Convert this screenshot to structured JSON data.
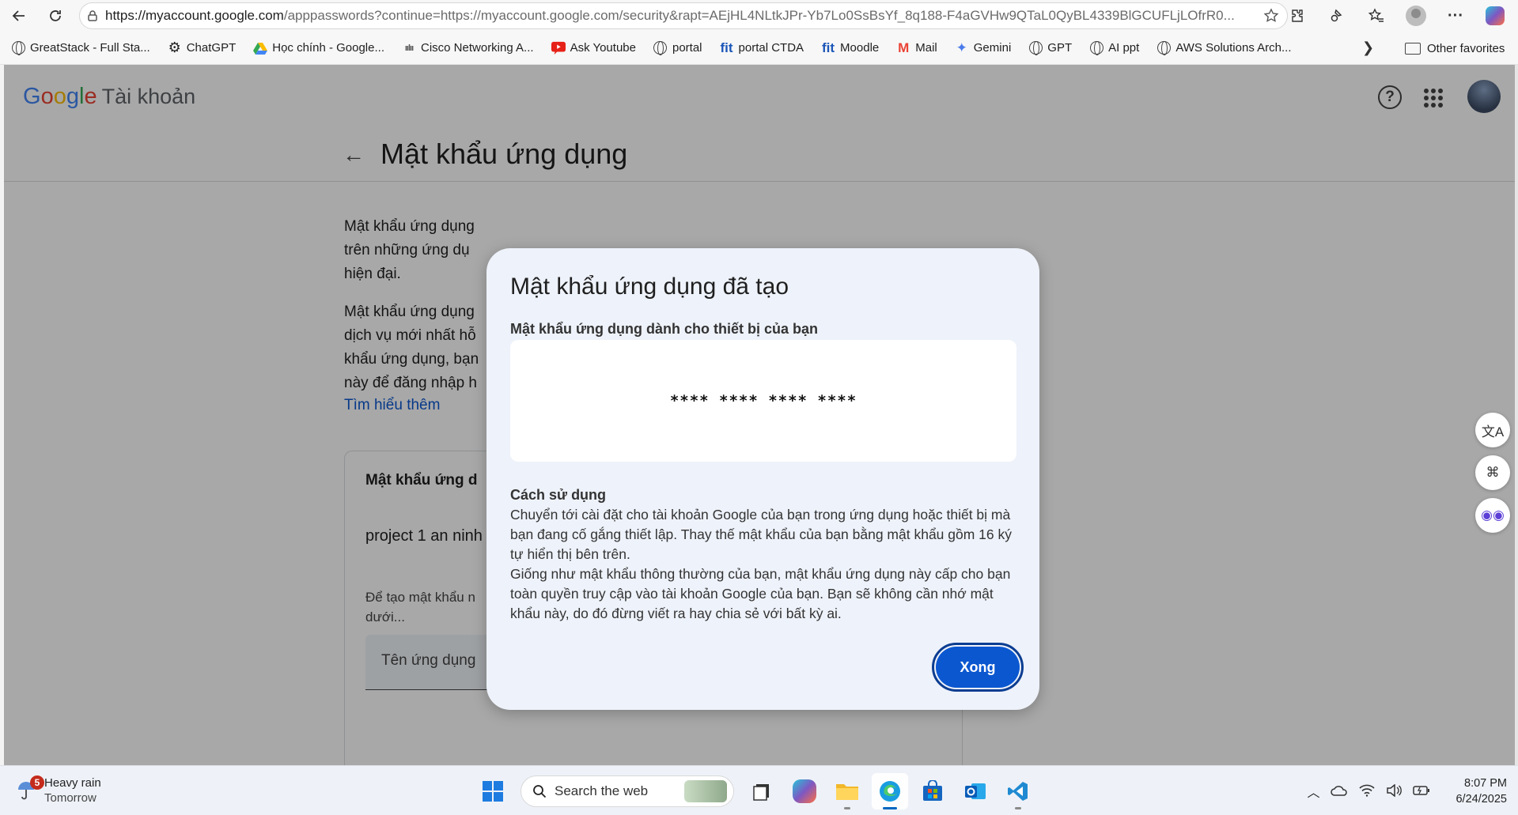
{
  "browser": {
    "url_main": "https://myaccount.google.com",
    "url_rest": "/apppasswords?continue=https://myaccount.google.com/security&rapt=AEjHL4NLtkJPr-Yb7Lo0SsBsYf_8q188-F4aGVHw9QTaL0QyBL4339BlGCUFLjLOfrR0...",
    "bookmarks": [
      {
        "label": "GreatStack - Full Sta...",
        "icon": "globe-icon"
      },
      {
        "label": "ChatGPT",
        "icon": "chatgpt-icon"
      },
      {
        "label": "Học chính - Google...",
        "icon": "google-drive-icon"
      },
      {
        "label": "Cisco Networking A...",
        "icon": "cisco-icon"
      },
      {
        "label": "Ask Youtube",
        "icon": "youtube-icon"
      },
      {
        "label": "portal",
        "icon": "globe-icon"
      },
      {
        "label": "portal CTDA",
        "icon": "fit-icon"
      },
      {
        "label": "Moodle",
        "icon": "fit-icon"
      },
      {
        "label": "Mail",
        "icon": "gmail-icon"
      },
      {
        "label": "Gemini",
        "icon": "gemini-icon"
      },
      {
        "label": "GPT",
        "icon": "globe-icon"
      },
      {
        "label": "AI ppt",
        "icon": "globe-icon"
      },
      {
        "label": "AWS Solutions Arch...",
        "icon": "globe-icon"
      }
    ],
    "other_favorites": "Other favorites"
  },
  "google": {
    "logo": "Google",
    "product": "Tài khoản",
    "page_title": "Mật khẩu ứng dụng",
    "para1": [
      "Mật khẩu ứng dụng",
      "trên những ứng dụ",
      "hiện đại."
    ],
    "para2": [
      "Mật khẩu ứng dụng",
      "dịch vụ mới nhất hỗ",
      "khẩu ứng dụng, bạn",
      "này để đăng nhập h"
    ],
    "learn_more": "Tìm hiểu thêm",
    "card_title": "Mật khẩu ứng d",
    "card_item": "project 1 an ninh",
    "card_hint": [
      "Để tạo mật khẩu n",
      "dưới..."
    ],
    "input_placeholder": "Tên ứng dụng"
  },
  "dialog": {
    "title": "Mật khẩu ứng dụng đã tạo",
    "password_label": "Mật khẩu ứng dụng dành cho thiết bị của bạn",
    "password_value": "**** **** **** ****",
    "usage_title": "Cách sử dụng",
    "usage_body_1": "Chuyển tới cài đặt cho tài khoản Google của bạn trong ứng dụng hoặc thiết bị mà bạn đang cố gắng thiết lập. Thay thế mật khẩu của bạn bằng mật khẩu gồm 16 ký tự hiển thị bên trên.",
    "usage_body_2": "Giống như mật khẩu thông thường của bạn, mật khẩu ứng dụng này cấp cho bạn toàn quyền truy cập vào tài khoản Google của bạn. Bạn sẽ không cần nhớ mật khẩu này, do đó đừng viết ra hay chia sẻ với bất kỳ ai.",
    "done_label": "Xong"
  },
  "taskbar": {
    "weather_badge": "5",
    "weather_title": "Heavy rain",
    "weather_sub": "Tomorrow",
    "search_placeholder": "Search the web",
    "time": "8:07 PM",
    "date": "6/24/2025"
  }
}
